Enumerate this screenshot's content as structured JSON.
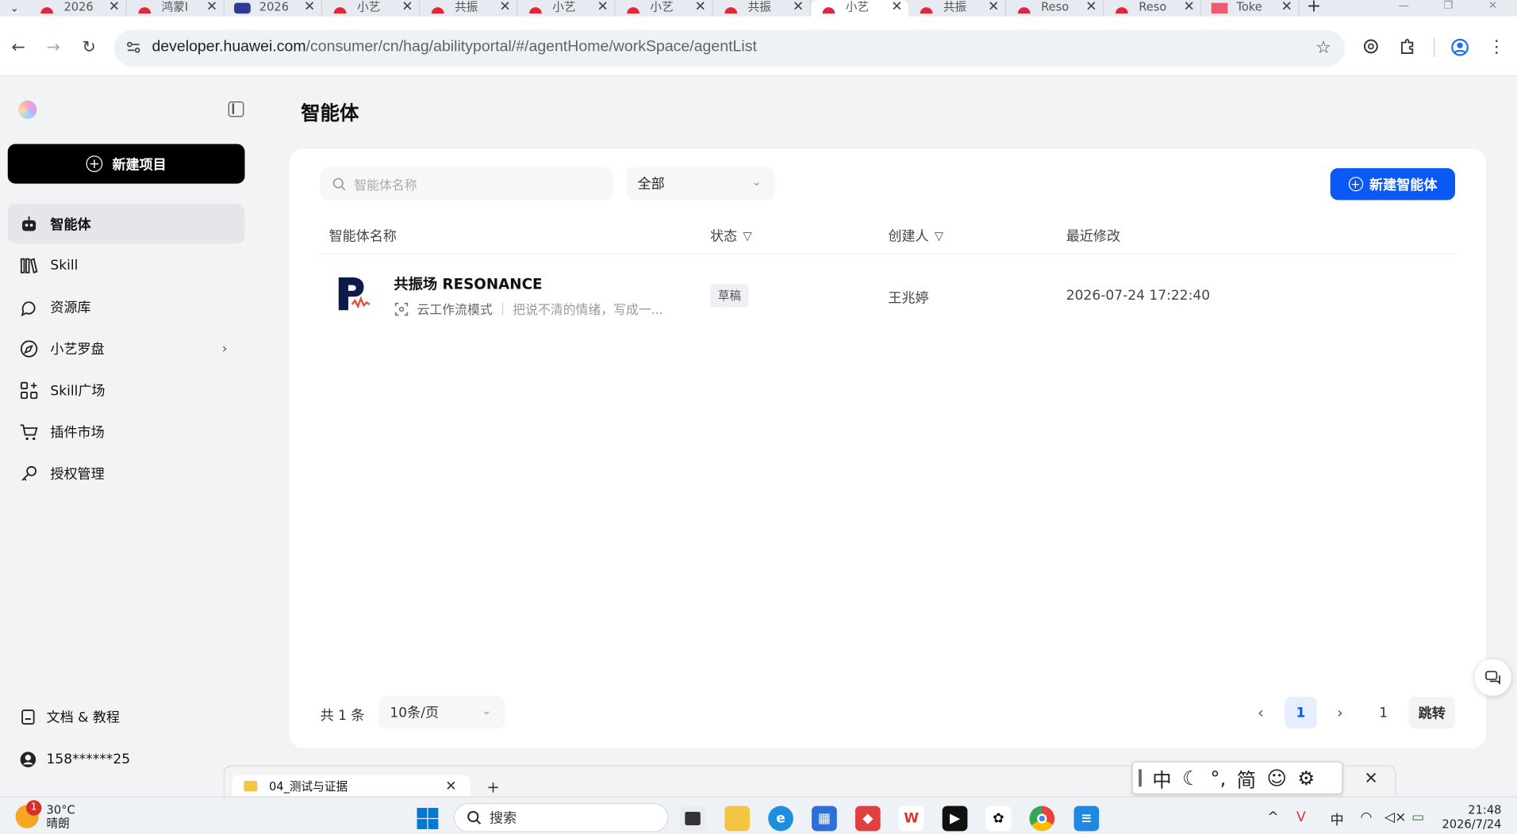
{
  "browser": {
    "tabs": [
      {
        "title": "2026",
        "icon": "huawei-icon",
        "active": false
      },
      {
        "title": "鸿蒙I",
        "icon": "huawei-icon",
        "active": false
      },
      {
        "title": "2026",
        "icon": "globe-icon",
        "active": false
      },
      {
        "title": "小艺",
        "icon": "huawei-icon",
        "active": false
      },
      {
        "title": "共振",
        "icon": "huawei-icon",
        "active": false
      },
      {
        "title": "小艺",
        "icon": "huawei-icon",
        "active": false
      },
      {
        "title": "小艺",
        "icon": "huawei-icon",
        "active": false
      },
      {
        "title": "共振",
        "icon": "huawei-icon",
        "active": false
      },
      {
        "title": "小艺",
        "icon": "huawei-icon",
        "active": true
      },
      {
        "title": "共振",
        "icon": "huawei-icon",
        "active": false
      },
      {
        "title": "Reso",
        "icon": "huawei-icon",
        "active": false
      },
      {
        "title": "Reso",
        "icon": "huawei-icon",
        "active": false
      },
      {
        "title": "Toke",
        "icon": "flower-icon",
        "active": false
      }
    ],
    "url_host": "developer.huawei.com",
    "url_path": "/consumer/cn/hag/abilityportal/#/agentHome/workSpace/agentList"
  },
  "sidebar": {
    "new_project": "新建项目",
    "items": [
      {
        "label": "智能体",
        "icon": "robot-icon",
        "active": true
      },
      {
        "label": "Skill",
        "icon": "books-icon",
        "active": false
      },
      {
        "label": "资源库",
        "icon": "resource-icon",
        "active": false
      },
      {
        "label": "小艺罗盘",
        "icon": "compass-icon",
        "active": false,
        "has_children": true
      },
      {
        "label": "Skill广场",
        "icon": "grid-plus-icon",
        "active": false
      },
      {
        "label": "插件市场",
        "icon": "cart-icon",
        "active": false
      },
      {
        "label": "授权管理",
        "icon": "key-icon",
        "active": false
      }
    ],
    "docs": "文档 & 教程",
    "user": "158******25"
  },
  "main": {
    "title": "智能体",
    "search_placeholder": "智能体名称",
    "filter_value": "全部",
    "new_agent": "新建智能体",
    "columns": {
      "name": "智能体名称",
      "status": "状态",
      "creator": "创建人",
      "modified": "最近修改"
    },
    "rows": [
      {
        "name": "共振场 RESONANCE",
        "mode": "云工作流模式",
        "desc": "把说不清的情绪，写成一...",
        "status": "草稿",
        "creator": "王兆婷",
        "modified": "2026-07-24 17:22:40"
      }
    ],
    "pagination": {
      "total": "共 1 条",
      "page_size": "10条/页",
      "current_page": "1",
      "jump_value": "1",
      "jump_label": "跳转"
    }
  },
  "explorer": {
    "tab_title": "04_测试与证据"
  },
  "ime": {
    "items": [
      "中",
      "简"
    ]
  },
  "taskbar": {
    "weather_temp": "30°C",
    "weather_desc": "晴朗",
    "weather_badge": "1",
    "search_placeholder": "搜索",
    "tray_lang": "中",
    "time": "21:48",
    "date": "2026/7/24"
  },
  "colors": {
    "accent": "#0a59f7",
    "sidebar_bg": "#f2f3f5",
    "primary_dark": "#000000"
  }
}
